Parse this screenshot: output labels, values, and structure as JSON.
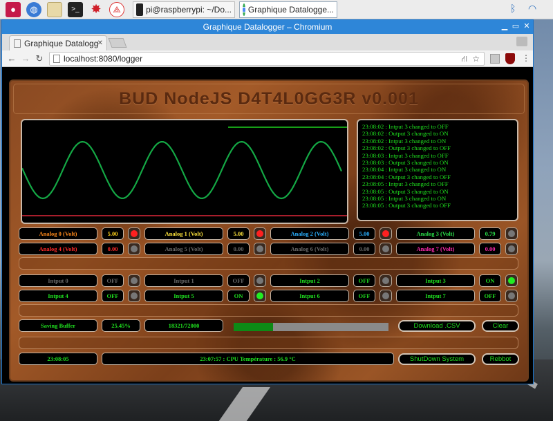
{
  "taskbar": {
    "tasks": [
      {
        "label": "pi@raspberrypi: ~/Do..."
      },
      {
        "label": "Graphique Datalogge..."
      }
    ]
  },
  "window": {
    "title": "Graphique Datalogger – Chromium",
    "tab_label": "Graphique Datalogg",
    "url": "localhost:8080/logger"
  },
  "app": {
    "title": "BUD NodeJS D4T4L0GG3R v0.001",
    "log": [
      "23:08:02 : Intput 3 changed to OFF",
      "23:08:02 : Output 3 changed to ON",
      "23:08:02 : Intput 3 changed to ON",
      "23:08:02 : Output 3 changed to OFF",
      "23:08:03 : Intput 3 changed to OFF",
      "23:08:03 : Output 3 changed to ON",
      "23:08:04 : Intput 3 changed to ON",
      "23:08:04 : Output 3 changed to OFF",
      "23:08:05 : Intput 3 changed to OFF",
      "23:08:05 : Output 3 changed to ON",
      "23:08:05 : Intput 3 changed to ON",
      "23:08:05 : Output 3 changed to OFF"
    ],
    "analog": [
      {
        "label": "Analog 0 (Volt)",
        "value": "5.00",
        "label_color": "#ff8a1a",
        "value_color": "#ffd21a",
        "led": "#ff2020"
      },
      {
        "label": "Analog 1 (Volt)",
        "value": "5.00",
        "label_color": "#ffe43a",
        "value_color": "#ffe43a",
        "led": "#ff2020"
      },
      {
        "label": "Analog 2 (Volt)",
        "value": "5.00",
        "label_color": "#2ab0ff",
        "value_color": "#2ab0ff",
        "led": "#ff2020"
      },
      {
        "label": "Analog 3 (Volt)",
        "value": "0.79",
        "label_color": "#2ae04a",
        "value_color": "#2ae04a",
        "led": "#777777"
      },
      {
        "label": "Analog 4 (Volt)",
        "value": "0.00",
        "label_color": "#ff2a2a",
        "value_color": "#ff2a2a",
        "led": "#777777"
      },
      {
        "label": "Analog 5 (Volt)",
        "value": "0.00",
        "label_color": "#6a6a6a",
        "value_color": "#6a6a6a",
        "led": "#777777"
      },
      {
        "label": "Analog 6 (Volt)",
        "value": "0.00",
        "label_color": "#6a6a6a",
        "value_color": "#6a6a6a",
        "led": "#777777"
      },
      {
        "label": "Analog 7 (Volt)",
        "value": "0.00",
        "label_color": "#ff2ab0",
        "value_color": "#ff2ab0",
        "led": "#777777"
      }
    ],
    "inputs": [
      {
        "label": "Intput 0",
        "value": "OFF",
        "active": false,
        "led": "#777777"
      },
      {
        "label": "Intput 1",
        "value": "OFF",
        "active": false,
        "led": "#777777"
      },
      {
        "label": "Intput 2",
        "value": "OFF",
        "active": true,
        "led": "#777777"
      },
      {
        "label": "Intput 3",
        "value": "ON",
        "active": true,
        "led": "#22ee22"
      },
      {
        "label": "Intput 4",
        "value": "OFF",
        "active": true,
        "led": "#777777"
      },
      {
        "label": "Intput 5",
        "value": "ON",
        "active": true,
        "led": "#22ee22"
      },
      {
        "label": "Intput 6",
        "value": "OFF",
        "active": true,
        "led": "#777777"
      },
      {
        "label": "Intput 7",
        "value": "OFF",
        "active": true,
        "led": "#777777"
      }
    ],
    "buffer": {
      "label": "Saving Buffer",
      "percent": "25.45%",
      "count": "18321/72000",
      "fill_fraction": 0.2545
    },
    "download_label": "Download .CSV",
    "clear_label": "Clear",
    "clock": "23:08:05",
    "status": "23:07:57 : CPU Température : 56.9 °C",
    "shutdown_label": "ShutDown System",
    "reboot_label": "Rebbot",
    "colors": {
      "green": "#1fe01f",
      "gray": "#6a6a6a"
    }
  }
}
